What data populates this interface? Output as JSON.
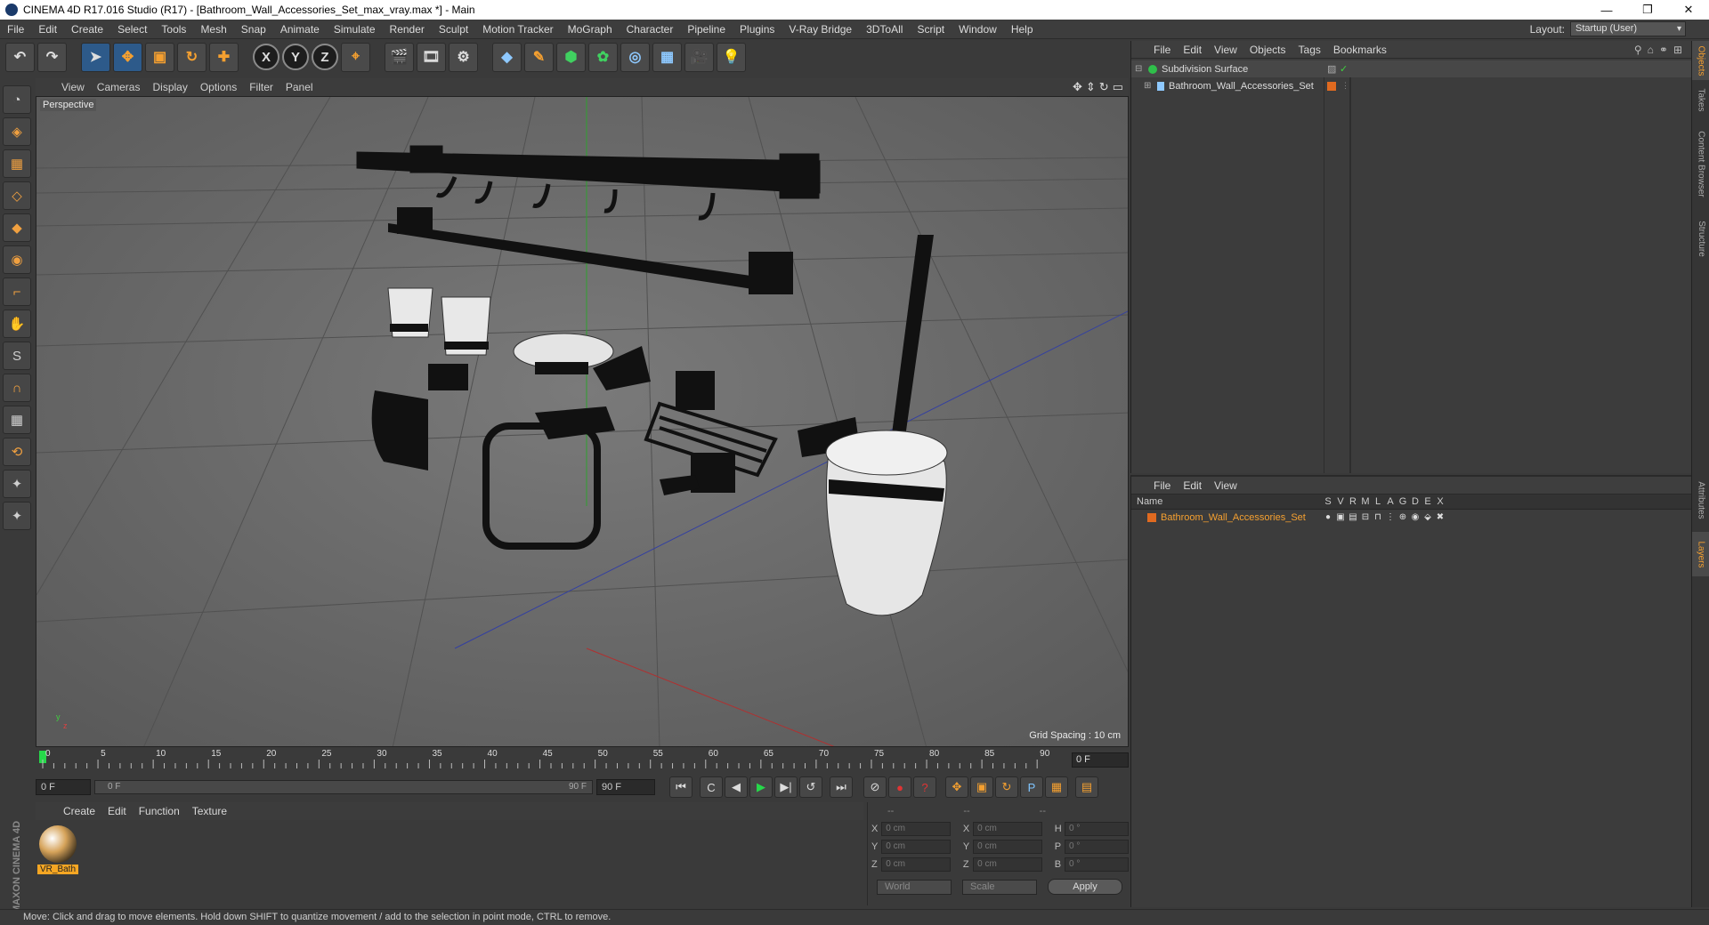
{
  "window": {
    "title": "CINEMA 4D R17.016 Studio (R17) - [Bathroom_Wall_Accessories_Set_max_vray.max *] - Main",
    "minimize": "—",
    "restore": "❐",
    "close": "✕"
  },
  "menubar": [
    "File",
    "Edit",
    "Create",
    "Select",
    "Tools",
    "Mesh",
    "Snap",
    "Animate",
    "Simulate",
    "Render",
    "Sculpt",
    "Motion Tracker",
    "MoGraph",
    "Character",
    "Pipeline",
    "Plugins",
    "V-Ray Bridge",
    "3DToAll",
    "Script",
    "Window",
    "Help"
  ],
  "layout": {
    "label": "Layout:",
    "value": "Startup (User)"
  },
  "toolbar": {
    "undo": "↶",
    "redo": "↷",
    "select": "➤",
    "move": "✥",
    "scale": "▣",
    "rotate": "↻",
    "add": "✚",
    "x_axis": "X",
    "y_axis": "Y",
    "z_axis": "Z",
    "coord": "⌖",
    "render_view": "🎬",
    "render_pic": "🎞",
    "render_settings": "⚙",
    "cube": "◆",
    "pen": "✎",
    "subdiv": "⬢",
    "mograph": "✿",
    "deformer": "◎",
    "floor": "▦",
    "camera": "🎥",
    "light": "💡"
  },
  "left_tools": [
    "◔",
    "◈",
    "▦",
    "◇",
    "◆",
    "◉",
    "⌐",
    "✋",
    "S",
    "∩",
    "▦",
    "⟲",
    "✦",
    "✦"
  ],
  "maxon": "MAXON CINEMA 4D",
  "viewport": {
    "menu": [
      "View",
      "Cameras",
      "Display",
      "Options",
      "Filter",
      "Panel"
    ],
    "nav_icons": [
      "✥",
      "⇕",
      "↻",
      "▭"
    ],
    "label": "Perspective",
    "grid_spacing": "Grid Spacing : 10 cm",
    "axis_y": "y",
    "axis_z": "z",
    "axis_x": "x"
  },
  "timeline": {
    "ticks": [
      "0",
      "5",
      "10",
      "15",
      "20",
      "25",
      "30",
      "35",
      "40",
      "45",
      "50",
      "55",
      "60",
      "65",
      "70",
      "75",
      "80",
      "85",
      "90"
    ],
    "current_frame": "0 F"
  },
  "playback": {
    "start": "0 F",
    "range_start": "0 F",
    "range_end": "90 F",
    "end": "90 F",
    "btn_first": "⏮",
    "btn_prev_key": "C",
    "btn_prev": "◀",
    "btn_play": "▶",
    "btn_next": "▶|",
    "btn_loop": "↺",
    "btn_last": "⏭",
    "btn_motion": "⊘",
    "btn_record": "●",
    "btn_auto": "?",
    "btn_move": "✥",
    "btn_scale": "▣",
    "btn_rotate": "↻",
    "btn_param": "P",
    "btn_grid": "▦",
    "btn_timeline": "▤"
  },
  "materials": {
    "menu": [
      "Create",
      "Edit",
      "Function",
      "Texture"
    ],
    "items": [
      {
        "name": "VR_Bath"
      }
    ]
  },
  "coordinates": {
    "headers": [
      "--",
      "--",
      "--"
    ],
    "rows": [
      {
        "a1": "X",
        "v1": "0 cm",
        "a2": "X",
        "v2": "0 cm",
        "a3": "H",
        "v3": "0 °"
      },
      {
        "a1": "Y",
        "v1": "0 cm",
        "a2": "Y",
        "v2": "0 cm",
        "a3": "P",
        "v3": "0 °"
      },
      {
        "a1": "Z",
        "v1": "0 cm",
        "a2": "Z",
        "v2": "0 cm",
        "a3": "B",
        "v3": "0 °"
      }
    ],
    "space": "World",
    "mode": "Scale",
    "apply": "Apply"
  },
  "objects": {
    "menu": [
      "File",
      "Edit",
      "View",
      "Objects",
      "Tags",
      "Bookmarks"
    ],
    "items": [
      {
        "name": "Subdivision Surface",
        "color": "#2fbf4a"
      },
      {
        "name": "Bathroom_Wall_Accessories_Set",
        "color": "#8ec9ff"
      }
    ]
  },
  "layers": {
    "menu": [
      "File",
      "Edit",
      "View"
    ],
    "columns": [
      "Name",
      "S",
      "V",
      "R",
      "M",
      "L",
      "A",
      "G",
      "D",
      "E",
      "X"
    ],
    "items": [
      {
        "name": "Bathroom_Wall_Accessories_Set",
        "color": "#e06a20"
      }
    ]
  },
  "right_tabs": [
    "Objects",
    "Takes",
    "Content Browser",
    "Structure",
    "Attributes",
    "Layers"
  ],
  "status": "Move: Click and drag to move elements. Hold down SHIFT to quantize movement / add to the selection in point mode, CTRL to remove."
}
